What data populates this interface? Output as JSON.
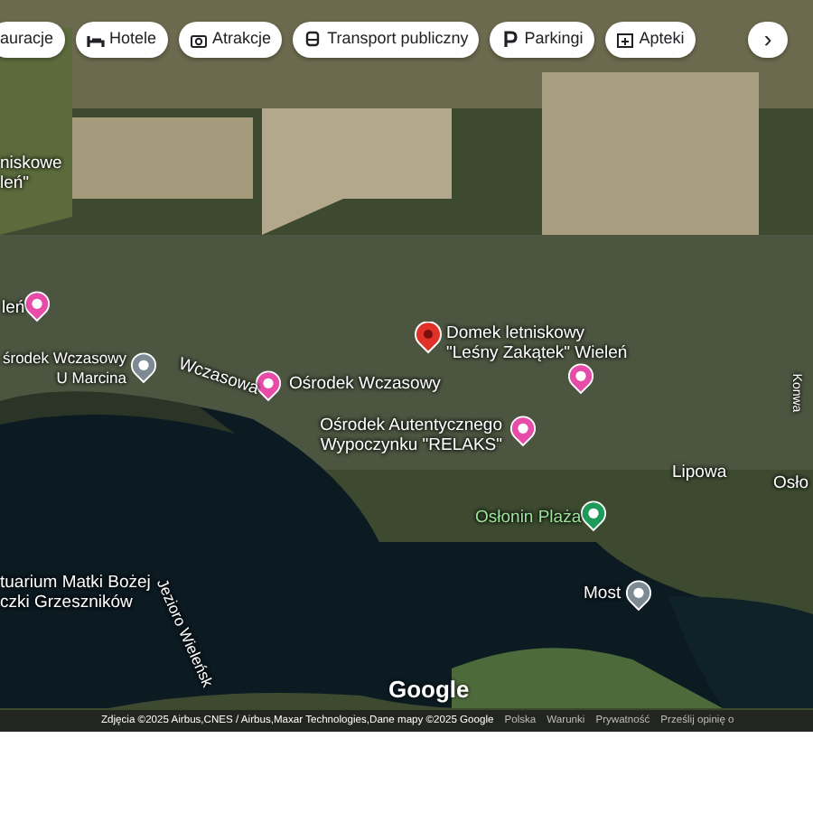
{
  "category_chips": [
    {
      "label": "auracje",
      "kind": "restaurant"
    },
    {
      "label": "Hotele",
      "kind": "hotel"
    },
    {
      "label": "Atrakcje",
      "kind": "camera"
    },
    {
      "label": "Transport publiczny",
      "kind": "transit"
    },
    {
      "label": "Parkingi",
      "kind": "parking"
    },
    {
      "label": "Apteki",
      "kind": "pharmacy"
    },
    {
      "label": "›",
      "kind": "next"
    }
  ],
  "map": {
    "places": [
      {
        "name": "leń",
        "kind": "hotel"
      },
      {
        "name": "środek Wczasowy\nU Marcina",
        "kind": "poi"
      },
      {
        "name": "Ośrodek Wczasowy",
        "kind": "hotel"
      },
      {
        "name": "Domek letniskowy\n\"Leśny Zakątek\" Wieleń",
        "kind": "pin"
      },
      {
        "kind": "hotel"
      },
      {
        "name": "Ośrodek Autentycznego\nWypoczynku \"RELAKS\"",
        "kind": "hotel"
      },
      {
        "name": "Osłonin Plaża",
        "kind": "beach"
      },
      {
        "name": "Most",
        "kind": "landmark"
      }
    ],
    "areas": [
      "niskowe\nleń\"",
      "Osło",
      "tuarium Matki Bożej\nczki Grzeszników"
    ],
    "streets": [
      "Wczasowa",
      "Lipowa",
      "Konwa"
    ],
    "water": "Jezioro Wieleńsk",
    "logo": "Google"
  },
  "footer": {
    "attribution": "Zdjęcia ©2025 Airbus,CNES / Airbus,Maxar Technologies,Dane mapy ©2025 Google",
    "links": [
      "Polska",
      "Warunki",
      "Prywatność",
      "Prześlij opinię o"
    ]
  }
}
